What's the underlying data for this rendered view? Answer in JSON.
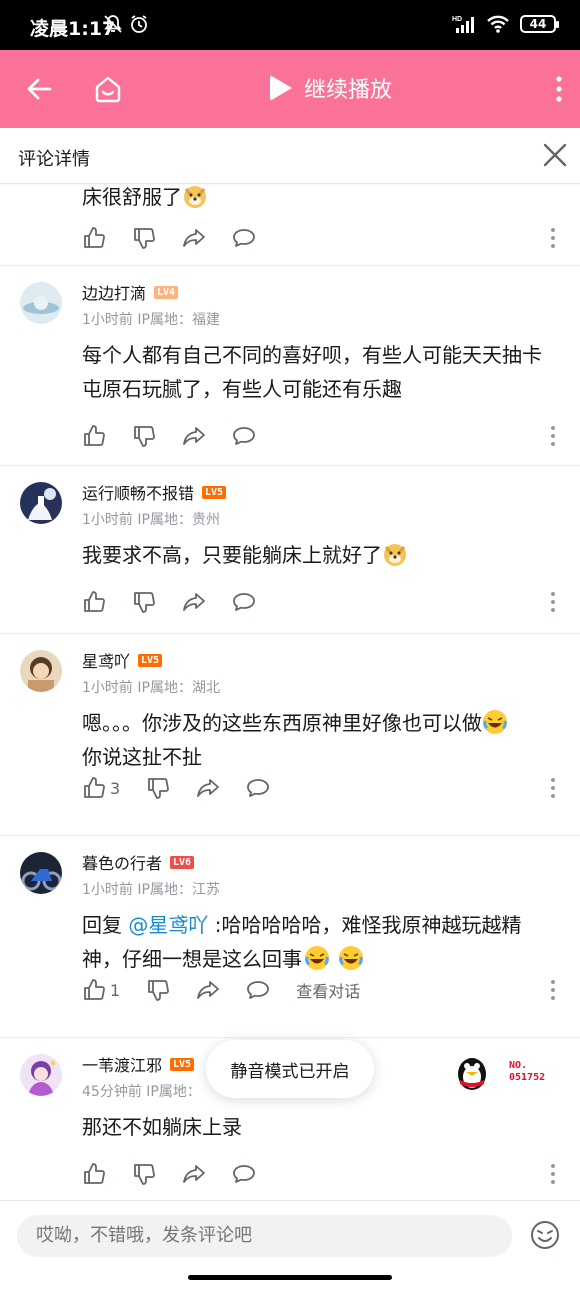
{
  "status_bar": {
    "time": "凌晨1:17",
    "network": "HD",
    "battery": "44"
  },
  "header": {
    "title": "继续播放",
    "back_icon": "back-arrow-icon",
    "home_icon": "home-icon",
    "play_icon": "play-icon",
    "more_icon": "more-vertical-icon"
  },
  "panel": {
    "title": "评论详情"
  },
  "partial_comment": {
    "text": "床很舒服了"
  },
  "comments": [
    {
      "user": "边边打滴",
      "level": "LV4",
      "level_color": "#ffb37c",
      "time": "1小时前",
      "ip": "IP属地：福建",
      "text": "每个人都有自己不同的喜好呗，有些人可能天天抽卡屯原石玩腻了，有些人可能还有乐趣",
      "likes": ""
    },
    {
      "user": "运行顺畅不报错",
      "level": "LV5",
      "level_color": "#ff6c00",
      "time": "1小时前",
      "ip": "IP属地：贵州",
      "text": "我要求不高，只要能躺床上就好了",
      "likes": ""
    },
    {
      "user": "星鸢吖",
      "level": "LV5",
      "level_color": "#ff6c00",
      "time": "1小时前",
      "ip": "IP属地：湖北",
      "text": "嗯。。。你涉及的这些东西原神里好像也可以做",
      "text2": "你说这扯不扯",
      "likes": "3"
    },
    {
      "user": "暮色の行者",
      "level": "LV6",
      "level_color": "#f04c49",
      "time": "1小时前",
      "ip": "IP属地：江苏",
      "reply_prefix": "回复 ",
      "mention": "@星鸢吖",
      "text": " :哈哈哈哈哈，难怪我原神越玩越精",
      "text2": "神，仔细一想是这么回事",
      "likes": "1",
      "view_conversation": "查看对话"
    },
    {
      "user": "一苇渡江邪",
      "level": "LV5",
      "level_color": "#ff6c00",
      "time": "45分钟前",
      "ip": "IP属地：",
      "text": "那还不如躺床上录",
      "likes": ""
    }
  ],
  "toast": "静音模式已开启",
  "badge": {
    "no_label": "NO.",
    "number": "051752"
  },
  "input": {
    "placeholder": "哎呦，不错哦，发条评论吧"
  }
}
